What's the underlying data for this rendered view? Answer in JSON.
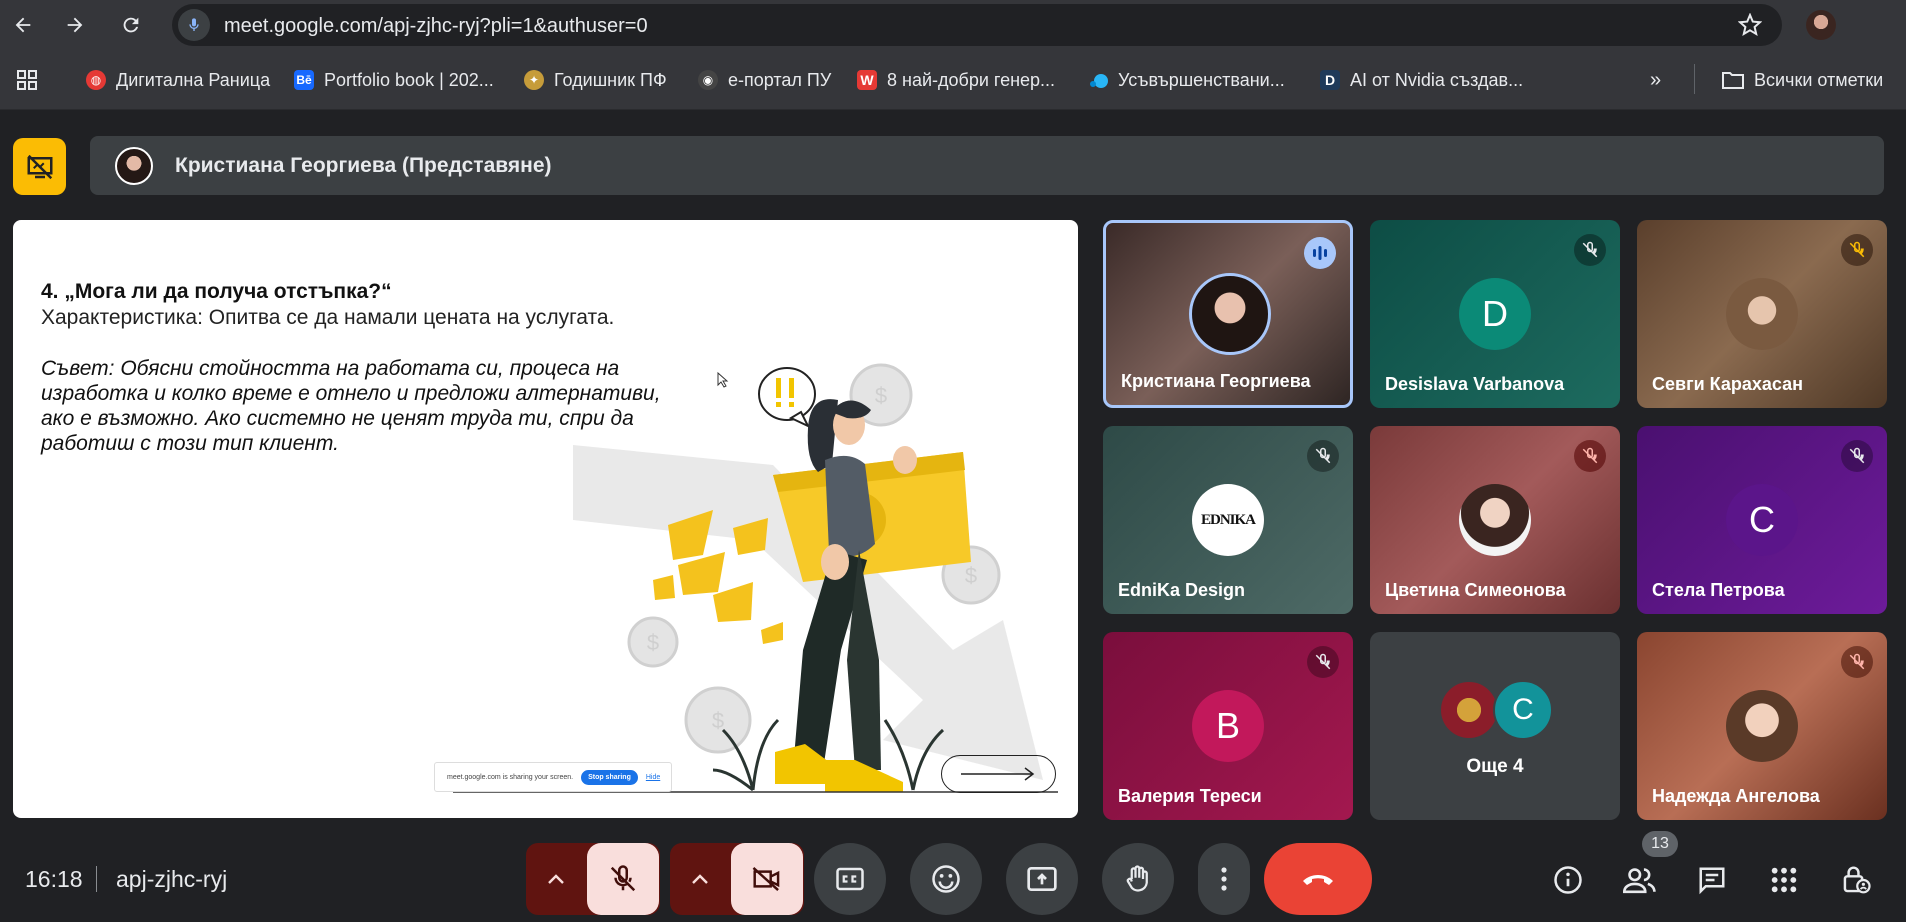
{
  "browser": {
    "url": "meet.google.com/apj-zjhc-ryj?pli=1&authuser=0",
    "bookmarks": [
      {
        "label": "Дигитална Раница",
        "icon": "digital-backpack-icon",
        "color": "#e53935"
      },
      {
        "label": "Portfolio book | 202...",
        "icon": "behance-icon",
        "color": "#1769ff"
      },
      {
        "label": "Годишник ПФ",
        "icon": "yearbook-icon",
        "color": "#c69c3a"
      },
      {
        "label": "е-портал ПУ",
        "icon": "portal-icon",
        "color": "#444444"
      },
      {
        "label": "8 най-добри генер...",
        "icon": "w-logo-icon",
        "color": "#e53935"
      },
      {
        "label": "Усъвършенствани...",
        "icon": "blue-dots-icon",
        "color": "#29b6f6"
      },
      {
        "label": "AI от Nvidia създав...",
        "icon": "d-logo-icon",
        "color": "#1f3a5a"
      }
    ],
    "all_bookmarks_label": "Всички отметки"
  },
  "meeting": {
    "presenter_label": "Кристиана Георгиева (Представяне)",
    "time": "16:18",
    "code": "apj-zjhc-ryj",
    "participants_count": "13"
  },
  "slide": {
    "title": "4. „Мога ли да получа отстъпка?“",
    "characteristic": "Характеристика: Опитва се да намали цената на услугата.",
    "advice": "Съвет: Обясни стойността на работата си, процеса на изработка и колко време е отнело и предложи алтернативи, ако е възможно. Ако системно не ценят труда ти, спри да работиш с този тип клиент.",
    "share_notice": "meet.google.com is sharing your screen.",
    "stop_sharing": "Stop sharing",
    "hide": "Hide"
  },
  "tiles": [
    {
      "name": "Кристиана Георгиева",
      "speaking": true
    },
    {
      "name": "Desislava Varbanova",
      "initial": "D",
      "muted": true
    },
    {
      "name": "Севги Карахасан",
      "muted": true
    },
    {
      "name": "EdniKa Design",
      "logo_text": "EDNIKA",
      "muted": true
    },
    {
      "name": "Цветина Симеонова",
      "muted": true
    },
    {
      "name": "Стела Петрова",
      "initial": "C",
      "muted": true
    },
    {
      "name": "Валерия Тереси",
      "initial": "B",
      "muted": true
    },
    {
      "name": "Още 4",
      "initial": "C"
    },
    {
      "name": "Надежда Ангелова",
      "muted": true
    }
  ],
  "colors": {
    "accent_yellow": "#fbbc04",
    "end_call_red": "#ea4335",
    "muted_control_bg": "#f9dedc",
    "muted_control_side": "#601410",
    "speaking_border": "#a8c7fa"
  }
}
